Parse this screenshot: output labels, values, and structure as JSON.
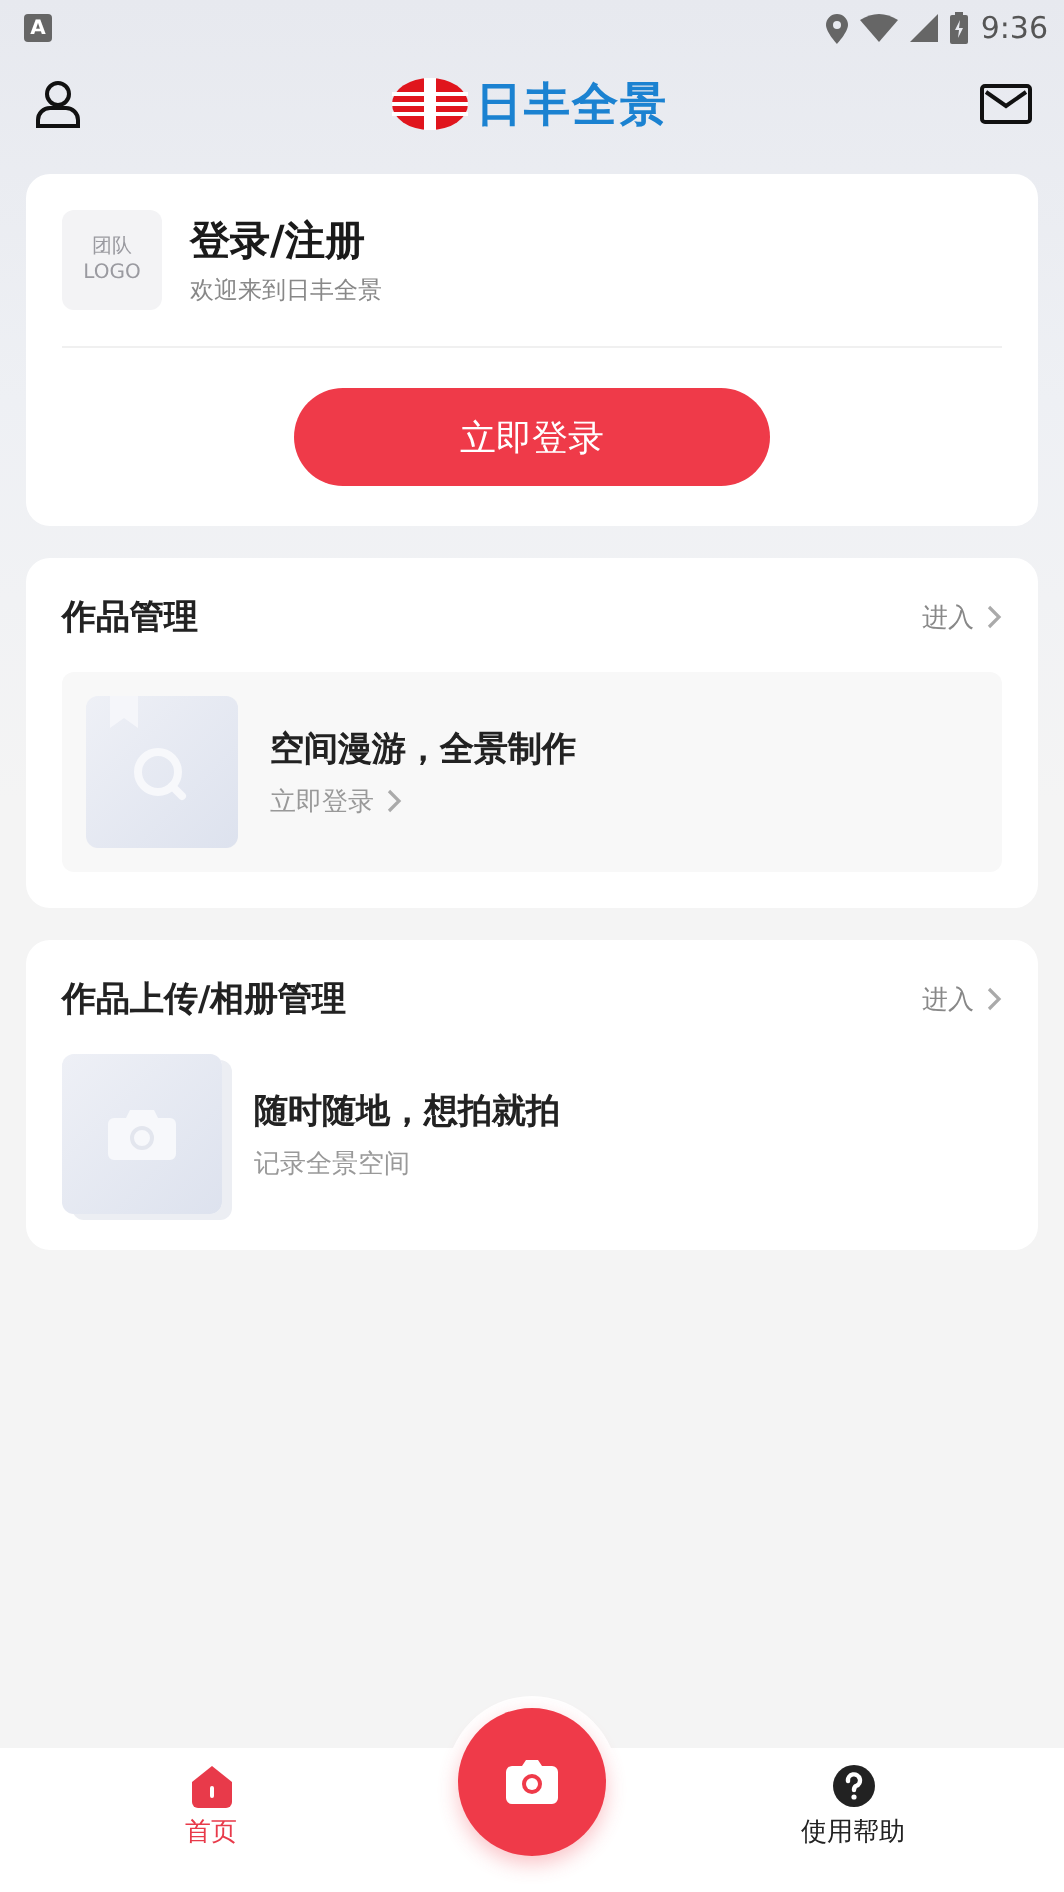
{
  "status_bar": {
    "time": "9:36",
    "notification": "A"
  },
  "header": {
    "logo_text": "日丰全景"
  },
  "login_card": {
    "logo_placeholder": [
      "团队",
      "LOGO"
    ],
    "title": "登录/注册",
    "subtitle": "欢迎来到日丰全景",
    "button": "立即登录"
  },
  "sections": [
    {
      "title": "作品管理",
      "link": "进入",
      "item": {
        "kind": "works",
        "title": "空间漫游，全景制作",
        "subtitle": "立即登录"
      }
    },
    {
      "title": "作品上传/相册管理",
      "link": "进入",
      "item": {
        "kind": "upload",
        "title": "随时随地，想拍就拍",
        "subtitle": "记录全景空间"
      }
    }
  ],
  "bottom_nav": [
    {
      "kind": "home",
      "label": "首页",
      "selected": true
    },
    {
      "kind": "camera"
    },
    {
      "kind": "help",
      "label": "使用帮助",
      "selected": false
    }
  ]
}
